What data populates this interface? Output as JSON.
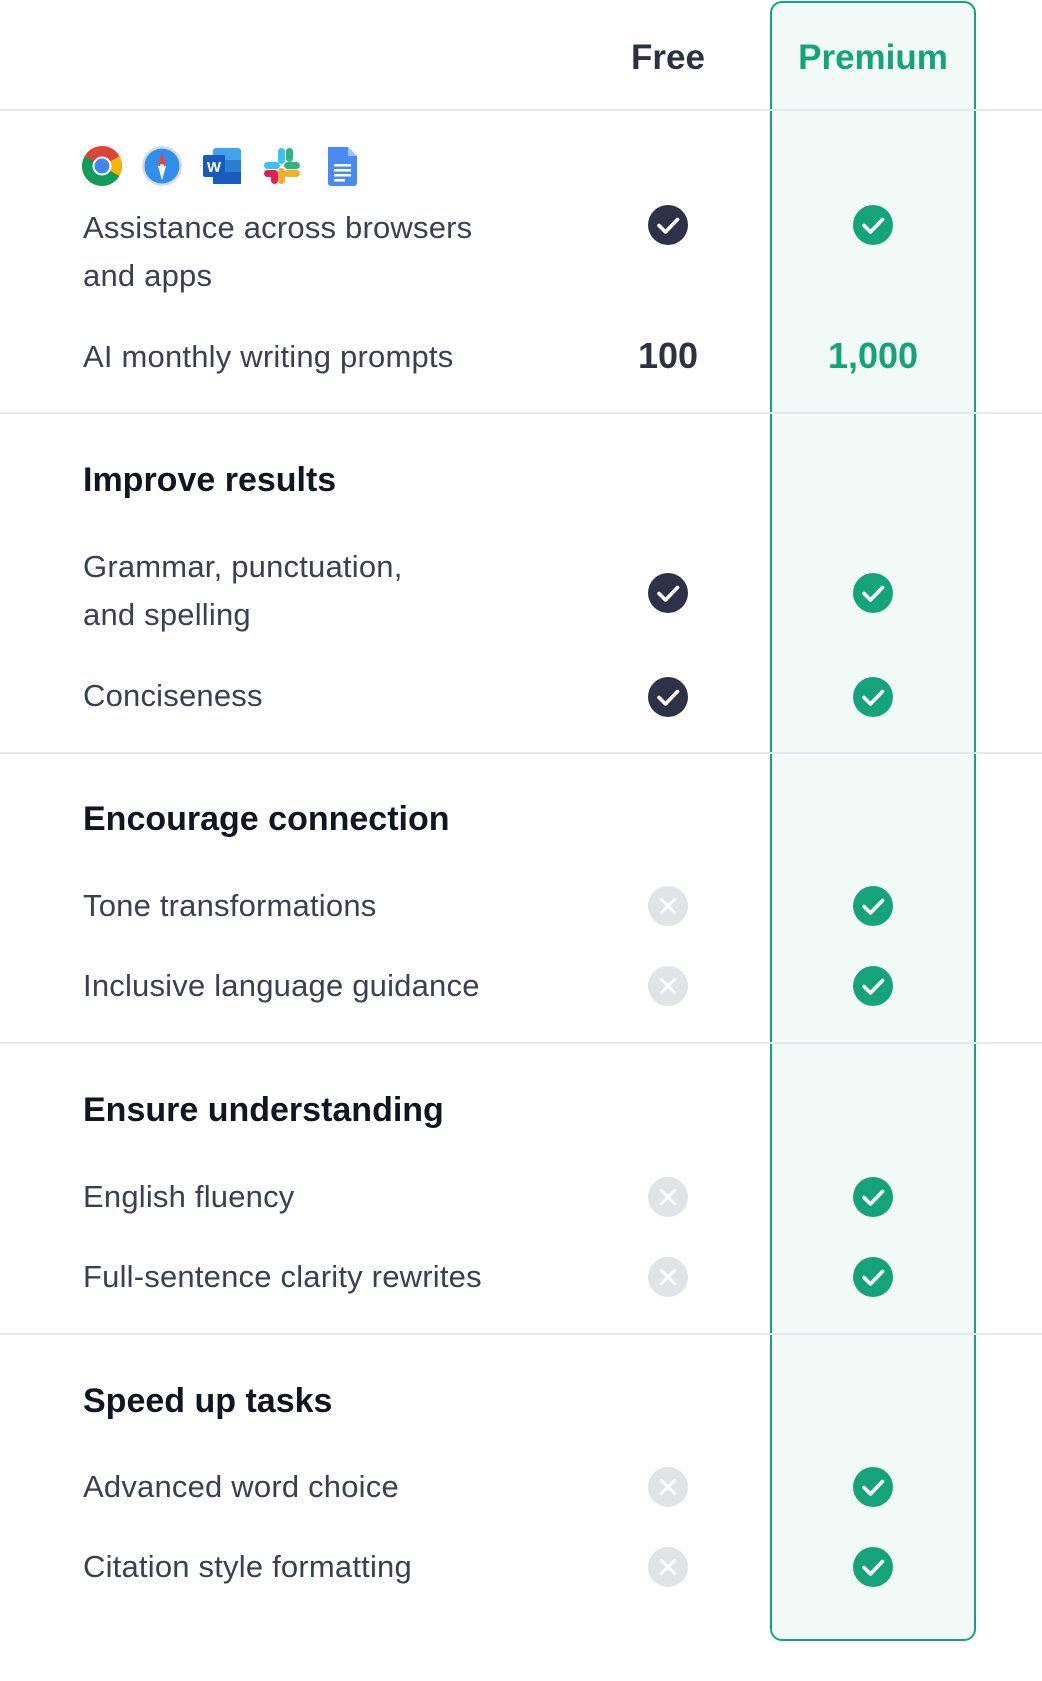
{
  "header": {
    "free_label": "Free",
    "premium_label": "Premium"
  },
  "colors": {
    "premium_accent": "#15a37a",
    "premium_bg": "#f1faf7",
    "free_check": "#2e3248",
    "unavailable": "#e2e3e6"
  },
  "app_icons": [
    "chrome-icon",
    "safari-icon",
    "word-icon",
    "slack-icon",
    "google-docs-icon"
  ],
  "intro": {
    "browsers_apps_line1": "Assistance across browsers",
    "browsers_apps_line2": "and apps",
    "prompts_label": "AI monthly writing prompts",
    "prompts_free": "100",
    "prompts_premium": "1,000"
  },
  "sections": [
    {
      "title": "Improve results",
      "features": [
        {
          "label_line1": "Grammar, punctuation,",
          "label_line2": "and spelling",
          "free": true,
          "premium": true
        },
        {
          "label_line1": "Conciseness",
          "free": true,
          "premium": true
        }
      ]
    },
    {
      "title": "Encourage connection",
      "features": [
        {
          "label_line1": "Tone transformations",
          "free": false,
          "premium": true
        },
        {
          "label_line1": "Inclusive language guidance",
          "free": false,
          "premium": true
        }
      ]
    },
    {
      "title": "Ensure understanding",
      "features": [
        {
          "label_line1": "English fluency",
          "free": false,
          "premium": true
        },
        {
          "label_line1": "Full-sentence clarity rewrites",
          "free": false,
          "premium": true
        }
      ]
    },
    {
      "title": "Speed up tasks",
      "features": [
        {
          "label_line1": "Advanced word choice",
          "free": false,
          "premium": true
        },
        {
          "label_line1": "Citation style formatting",
          "free": false,
          "premium": true
        }
      ]
    }
  ]
}
